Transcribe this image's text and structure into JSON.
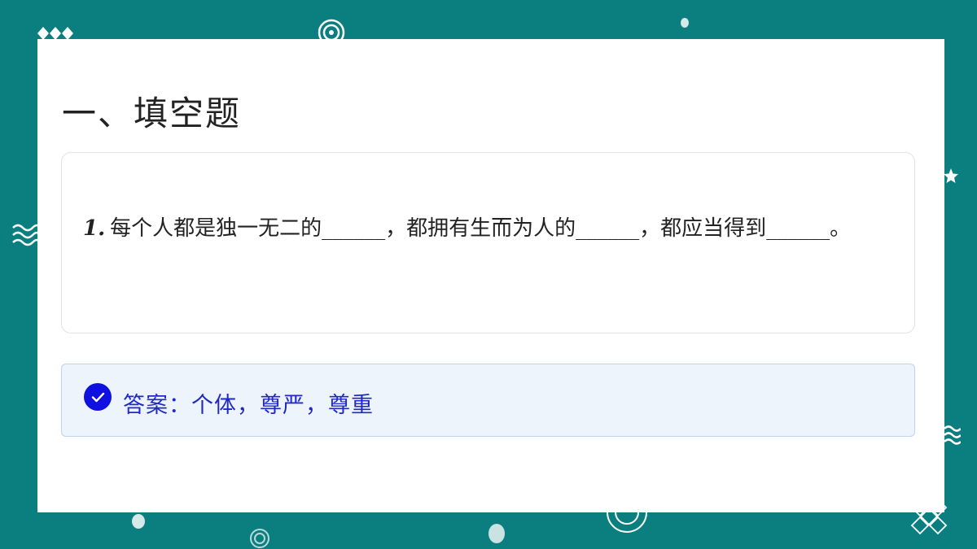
{
  "slide": {
    "title": "一、填空题",
    "question": {
      "number": "1.",
      "text": "每个人都是独一无二的______，都拥有生而为人的______，都应当得到______。"
    },
    "answer": {
      "text": "答案：个体，尊严，尊重"
    }
  },
  "icons": {
    "answer_check": "check-circle-icon",
    "decorations": [
      "diamonds",
      "concentric-circles",
      "wave-lines",
      "star",
      "dots",
      "spiral",
      "lattice"
    ]
  },
  "colors": {
    "background": "#0b7f80",
    "card": "#ffffff",
    "answer_bg": "#eef4fc",
    "answer_text": "#1f28c8",
    "check": "#1010e0"
  }
}
